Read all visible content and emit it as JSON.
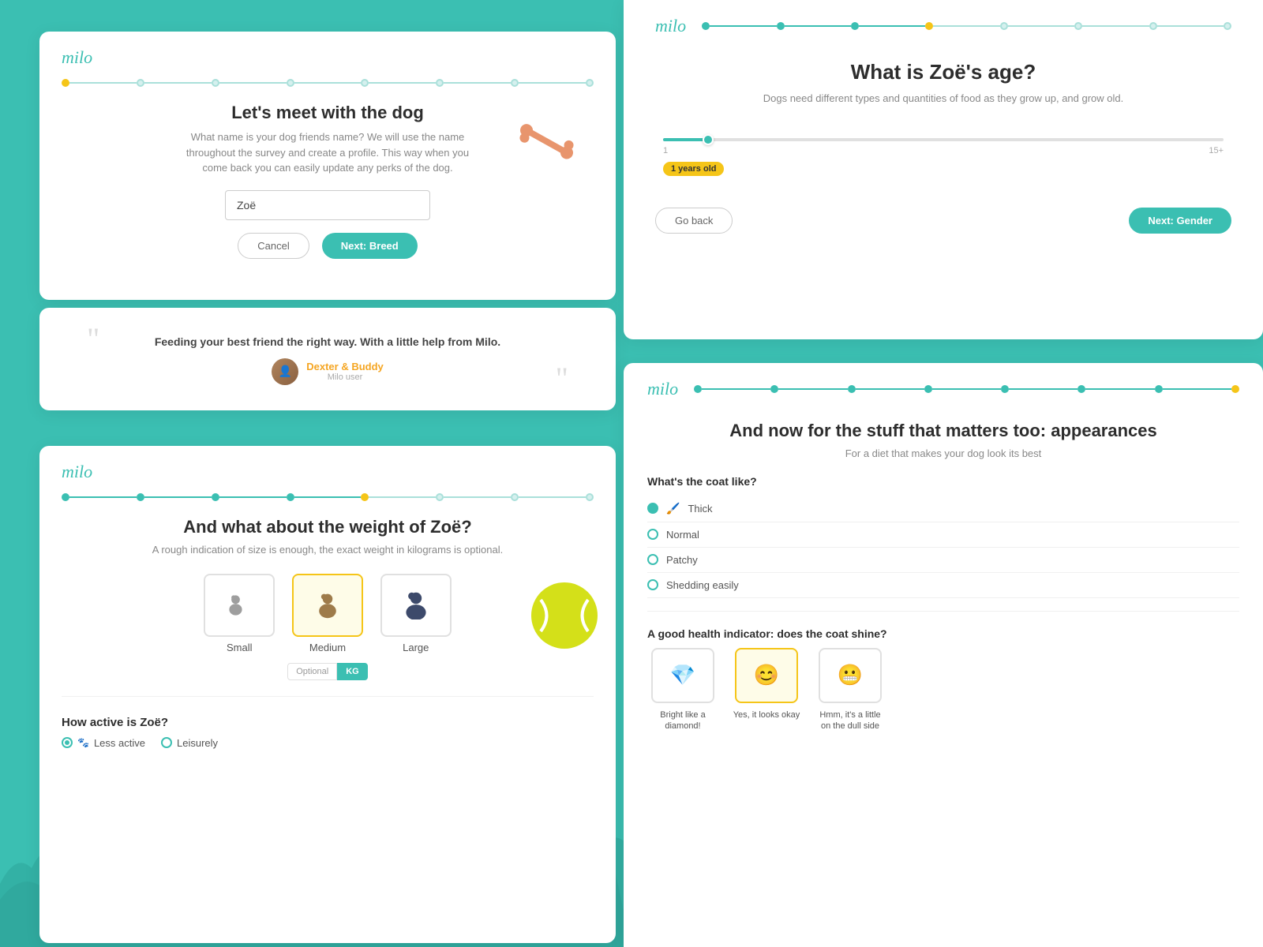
{
  "brand": {
    "logo": "milo"
  },
  "card1": {
    "title": "Let's meet with the dog",
    "subtitle": "What name is your dog friends name? We will use the name throughout the survey and create a profile. This way when you come back you can easily update any perks of the dog.",
    "input_placeholder": "Zoë",
    "input_value": "Zoë",
    "cancel_label": "Cancel",
    "next_label": "Next: Breed",
    "progress_steps": 8,
    "active_step": 0
  },
  "card2": {
    "quote": "Feeding your best friend the right way. With a little help from Milo.",
    "author_name": "Dexter & Buddy",
    "author_role": "Milo user"
  },
  "card3": {
    "title": "And what about the weight of Zoë?",
    "subtitle": "A rough indication of size is enough, the exact weight in kilograms is optional.",
    "sizes": [
      "Small",
      "Medium",
      "Large"
    ],
    "selected_size": "Medium",
    "optional_label": "Optional",
    "kg_label": "KG",
    "activity_title": "How active is Zoë?",
    "activity_options": [
      "Less active",
      "Leisurely"
    ],
    "progress_active_step": 4
  },
  "card4": {
    "title": "What is Zoë's age?",
    "subtitle": "Dogs need different types and quantities of food as they grow up, and grow old.",
    "age_badge": "1 years old",
    "slider_min": "1",
    "slider_max": "15+",
    "go_back_label": "Go back",
    "next_label": "Next: Gender",
    "progress_active_step": 3
  },
  "card5": {
    "title": "And now for the stuff that matters too: appearances",
    "subtitle": "For a diet that makes your dog look its best",
    "coat_section_title": "What's the coat like?",
    "coat_options": [
      "Thick",
      "Normal",
      "Patchy",
      "Shedding easily"
    ],
    "selected_coat": "Thick",
    "shine_section_title": "A good health indicator: does the coat shine?",
    "shine_options": [
      {
        "label": "Bright like a diamond!",
        "icon": "💎",
        "selected": false
      },
      {
        "label": "Yes, it looks okay",
        "icon": "😊",
        "selected": true
      },
      {
        "label": "Hmm, it's a little on the dull side",
        "icon": "😬",
        "selected": false
      }
    ],
    "progress_active_step": 7
  }
}
